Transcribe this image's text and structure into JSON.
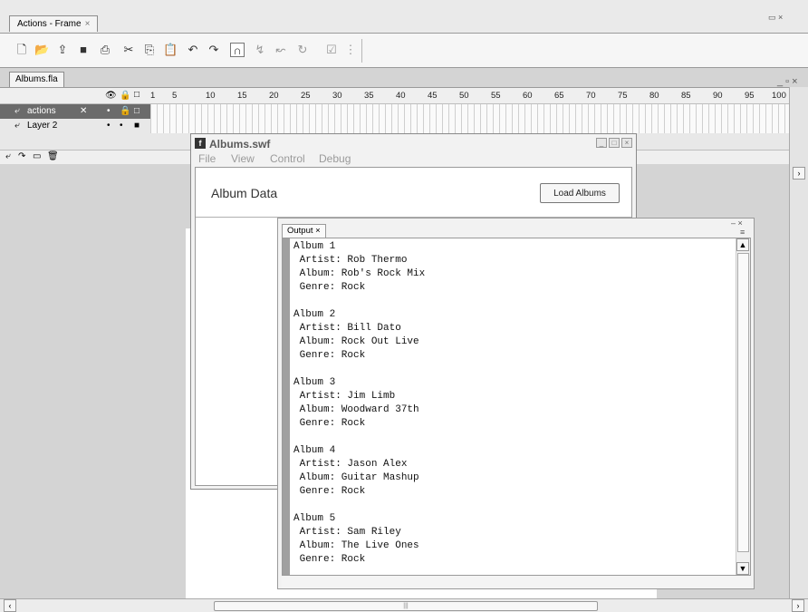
{
  "actions_panel": {
    "tab_label": "Actions - Frame",
    "tab_close": "×",
    "toolbar_icons": [
      "new-file-icon",
      "open-icon",
      "save-as-icon",
      "save-icon",
      "print-icon",
      "cut-icon",
      "copy-icon",
      "paste-icon",
      "undo-icon",
      "redo-icon",
      "magnet-icon",
      "step-in-icon",
      "step-out-icon",
      "refresh-icon",
      "check-icon",
      "debug-options-icon"
    ],
    "panel_controls": "▭ ×"
  },
  "document": {
    "tab_label": "Albums.fla",
    "window_controls": "_ ▫ ×",
    "frame_numbers": [
      "1",
      "5",
      "10",
      "15",
      "20",
      "25",
      "30",
      "35",
      "40",
      "45",
      "50",
      "55",
      "60",
      "65",
      "70",
      "75",
      "80",
      "85",
      "90",
      "95",
      "100"
    ],
    "layers": [
      {
        "name": "actions",
        "selected": true
      },
      {
        "name": "Layer 2",
        "selected": false
      }
    ],
    "layer_header_icons": [
      "eye-icon",
      "lock-icon",
      "outline-icon"
    ]
  },
  "swf_window": {
    "title": "Albums.swf",
    "menu": [
      "File",
      "View",
      "Control",
      "Debug"
    ],
    "heading": "Album Data",
    "button_label": "Load Albums"
  },
  "output_panel": {
    "tab_label": "Output",
    "tab_close": "×",
    "controls": "– ×",
    "lines": [
      "Album 1",
      " Artist: Rob Thermo",
      " Album: Rob's Rock Mix",
      " Genre: Rock",
      "",
      "Album 2",
      " Artist: Bill Dato",
      " Album: Rock Out Live",
      " Genre: Rock",
      "",
      "Album 3",
      " Artist: Jim Limb",
      " Album: Woodward 37th",
      " Genre: Rock",
      "",
      "Album 4",
      " Artist: Jason Alex",
      " Album: Guitar Mashup",
      " Genre: Rock",
      "",
      "Album 5",
      " Artist: Sam Riley",
      " Album: The Live Ones",
      " Genre: Rock"
    ]
  }
}
